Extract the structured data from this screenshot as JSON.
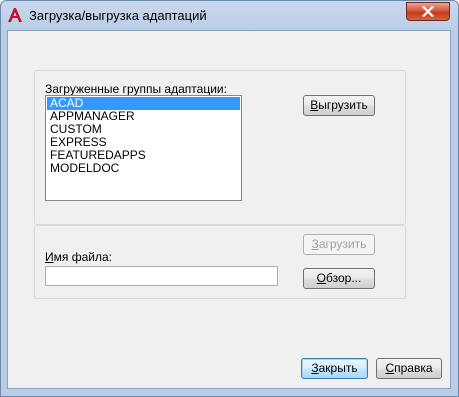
{
  "window": {
    "title": "Загрузка/выгрузка адаптаций",
    "icon": "autocad-a-icon",
    "close_icon": "close-x-icon"
  },
  "loaded_groups": {
    "label": "Загруженные группы адаптации:",
    "items": [
      "ACAD",
      "APPMANAGER",
      "CUSTOM",
      "EXPRESS",
      "FEATUREDAPPS",
      "MODELDOC"
    ],
    "selected": "ACAD"
  },
  "buttons": {
    "unload_prefix": "В",
    "unload_rest": "ыгрузить",
    "load_prefix": "З",
    "load_rest": "агрузить",
    "browse_prefix": "О",
    "browse_rest": "бзор...",
    "close_prefix": "З",
    "close_rest": "акрыть",
    "help_prefix": "С",
    "help_rest": "правка"
  },
  "file": {
    "label_prefix": "И",
    "label_rest": "мя файла:",
    "value": ""
  },
  "colors": {
    "selection": "#3399ff",
    "close_button": "#c43a1c"
  }
}
